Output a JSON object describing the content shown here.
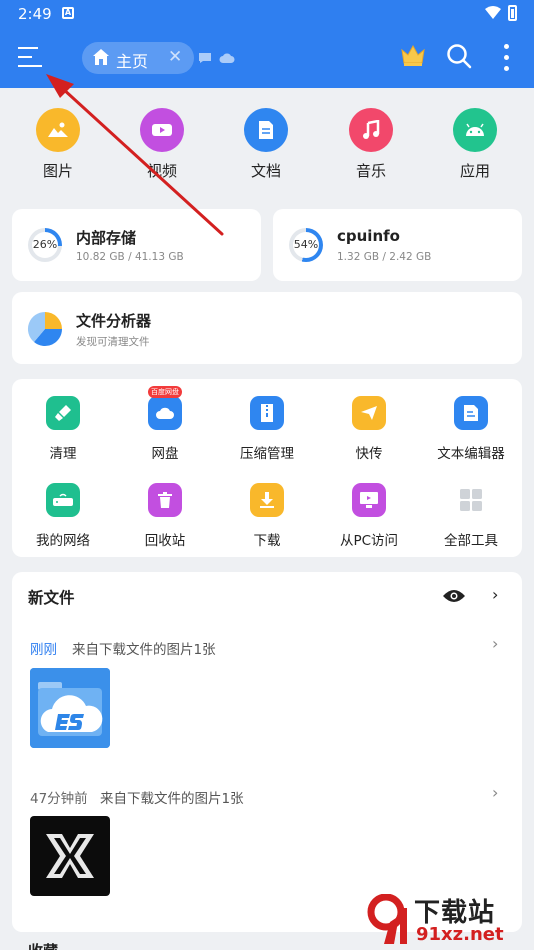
{
  "status_bar": {
    "time": "2:49",
    "sim_letter": "A"
  },
  "app_bar": {
    "tab_label": "主页",
    "tab_close": "✕"
  },
  "categories": [
    {
      "label": "图片",
      "color": "#f9b82b",
      "icon": "image-icon"
    },
    {
      "label": "视频",
      "color": "#c24fe0",
      "icon": "video-icon"
    },
    {
      "label": "文档",
      "color": "#2f86f0",
      "icon": "document-icon"
    },
    {
      "label": "音乐",
      "color": "#f2486b",
      "icon": "music-icon"
    },
    {
      "label": "应用",
      "color": "#22c48e",
      "icon": "android-icon"
    }
  ],
  "storage": {
    "internal": {
      "title": "内部存储",
      "percent": "26%",
      "usage": "10.82 GB / 41.13 GB",
      "fraction": 0.26
    },
    "cpuinfo": {
      "title": "cpuinfo",
      "percent": "54%",
      "usage": "1.32 GB / 2.42 GB",
      "fraction": 0.54
    }
  },
  "analyzer": {
    "title": "文件分析器",
    "subtitle": "发现可清理文件"
  },
  "tools": [
    {
      "label": "清理",
      "color": "#1fbf8f",
      "icon": "broom-icon"
    },
    {
      "label": "网盘",
      "color": "#2f86f0",
      "icon": "cloud-drive-icon",
      "badge": "百度网盘"
    },
    {
      "label": "压缩管理",
      "color": "#2f86f0",
      "icon": "zip-icon"
    },
    {
      "label": "快传",
      "color": "#f9b82b",
      "icon": "send-icon"
    },
    {
      "label": "文本编辑器",
      "color": "#2f86f0",
      "icon": "text-editor-icon"
    },
    {
      "label": "我的网络",
      "color": "#1fbf8f",
      "icon": "router-icon"
    },
    {
      "label": "回收站",
      "color": "#c24fe0",
      "icon": "trash-icon"
    },
    {
      "label": "下载",
      "color": "#f9b82b",
      "icon": "download-icon"
    },
    {
      "label": "从PC访问",
      "color": "#c24fe0",
      "icon": "pc-access-icon"
    },
    {
      "label": "全部工具",
      "color": "#cfd3d8",
      "icon": "grid-icon"
    }
  ],
  "new_files": {
    "title": "新文件",
    "groups": [
      {
        "time": "刚刚",
        "desc": "来自下载文件的图片1张",
        "time_color": "#2f7ff0",
        "thumb": "es-explorer-logo"
      },
      {
        "time": "47分钟前",
        "desc": "来自下载文件的图片1张",
        "time_color": "#666666",
        "thumb": "x-logo"
      }
    ]
  },
  "bottom_section_title": "收藏",
  "watermark": {
    "logo_text": "9",
    "text": "下载站",
    "url": "91xz.net"
  },
  "colors": {
    "primary": "#2f7ff0",
    "background": "#eef0f3",
    "annotation_arrow": "#d32020"
  }
}
